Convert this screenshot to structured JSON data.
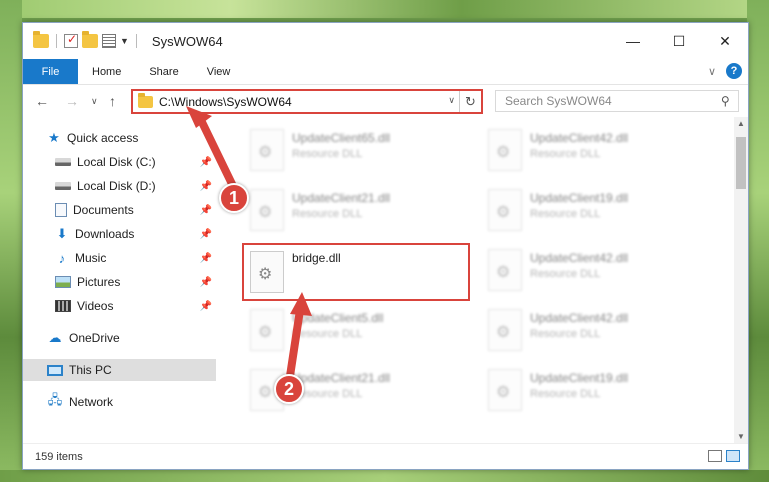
{
  "window": {
    "title": "SysWOW64",
    "minimize_icon": "—",
    "maximize_icon": "☐",
    "close_icon": "✕"
  },
  "ribbon": {
    "tabs": [
      "File",
      "Home",
      "Share",
      "View"
    ],
    "collapse_icon": "∨",
    "help_icon": "?"
  },
  "navigation": {
    "back_icon": "←",
    "forward_icon": "→",
    "recent_icon": "∨",
    "up_icon": "↑",
    "address": "C:\\Windows\\SysWOW64",
    "address_dropdown_icon": "∨",
    "refresh_icon": "↻",
    "search_placeholder": "Search SysWOW64",
    "search_icon": "⚲"
  },
  "sidebar": {
    "pin_icon": "📌",
    "items": [
      {
        "label": "Quick access",
        "icon": "star-icon"
      },
      {
        "label": "Local Disk (C:)",
        "icon": "disk-icon"
      },
      {
        "label": "Local Disk (D:)",
        "icon": "disk-icon"
      },
      {
        "label": "Documents",
        "icon": "documents-icon"
      },
      {
        "label": "Downloads",
        "icon": "downloads-icon"
      },
      {
        "label": "Music",
        "icon": "music-icon"
      },
      {
        "label": "Pictures",
        "icon": "pictures-icon"
      },
      {
        "label": "Videos",
        "icon": "videos-icon"
      },
      {
        "label": "OneDrive",
        "icon": "cloud-icon"
      },
      {
        "label": "This PC",
        "icon": "pc-icon"
      },
      {
        "label": "Network",
        "icon": "network-icon"
      }
    ],
    "glyphs": {
      "star": "★",
      "download": "⬇",
      "music": "♪",
      "cloud": "☁",
      "network": "🖧"
    }
  },
  "files": [
    {
      "name": "UpdateClient65.dll",
      "type": "Resource DLL"
    },
    {
      "name": "UpdateClient42.dll",
      "type": "Resource DLL"
    },
    {
      "name": "UpdateClient21.dll",
      "type": "Resource DLL"
    },
    {
      "name": "UpdateClient19.dll",
      "type": "Resource DLL"
    },
    {
      "name": "bridge.dll",
      "type": ""
    },
    {
      "name": "UpdateClient42.dll",
      "type": "Resource DLL"
    },
    {
      "name": "UpdateClient5.dll",
      "type": "Resource DLL"
    },
    {
      "name": "UpdateClient42.dll",
      "type": "Resource DLL"
    },
    {
      "name": "UpdateClient21.dll",
      "type": "Resource DLL"
    },
    {
      "name": "UpdateClient19.dll",
      "type": "Resource DLL"
    }
  ],
  "status": {
    "item_count": "159 items"
  },
  "annotations": {
    "step1": "1",
    "step2": "2",
    "color": "#d9443c"
  }
}
